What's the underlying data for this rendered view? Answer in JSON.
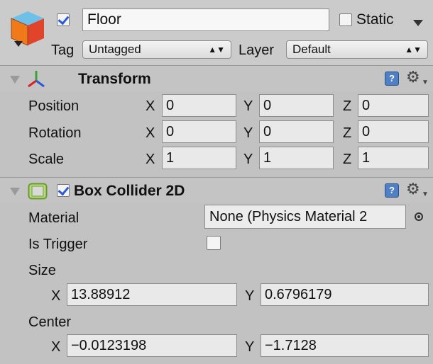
{
  "header": {
    "object_name": "Floor",
    "active": true,
    "static_label": "Static",
    "static_checked": false,
    "tag_label": "Tag",
    "tag_value": "Untagged",
    "layer_label": "Layer",
    "layer_value": "Default",
    "icon": "gameobject-cube-icon"
  },
  "transform": {
    "title": "Transform",
    "icon": "transform-axes-icon",
    "rows": [
      {
        "label": "Position",
        "x": "0",
        "y": "0",
        "z": "0"
      },
      {
        "label": "Rotation",
        "x": "0",
        "y": "0",
        "z": "0"
      },
      {
        "label": "Scale",
        "x": "1",
        "y": "1",
        "z": "1"
      }
    ],
    "axis_x": "X",
    "axis_y": "Y",
    "axis_z": "Z"
  },
  "box_collider": {
    "title": "Box Collider 2D",
    "enabled": true,
    "icon": "box-collider-icon",
    "material_label": "Material",
    "material_value": "None (Physics Material 2",
    "is_trigger_label": "Is Trigger",
    "is_trigger_checked": false,
    "size_label": "Size",
    "size_x": "13.88912",
    "size_y": "0.6796179",
    "center_label": "Center",
    "center_x": "−0.0123198",
    "center_y": "−1.7128",
    "axis_x": "X",
    "axis_y": "Y"
  },
  "colors": {
    "panel_bg": "#c2c2c2",
    "help_blue": "#4f7fc4",
    "check_blue": "#2a5bd7"
  }
}
